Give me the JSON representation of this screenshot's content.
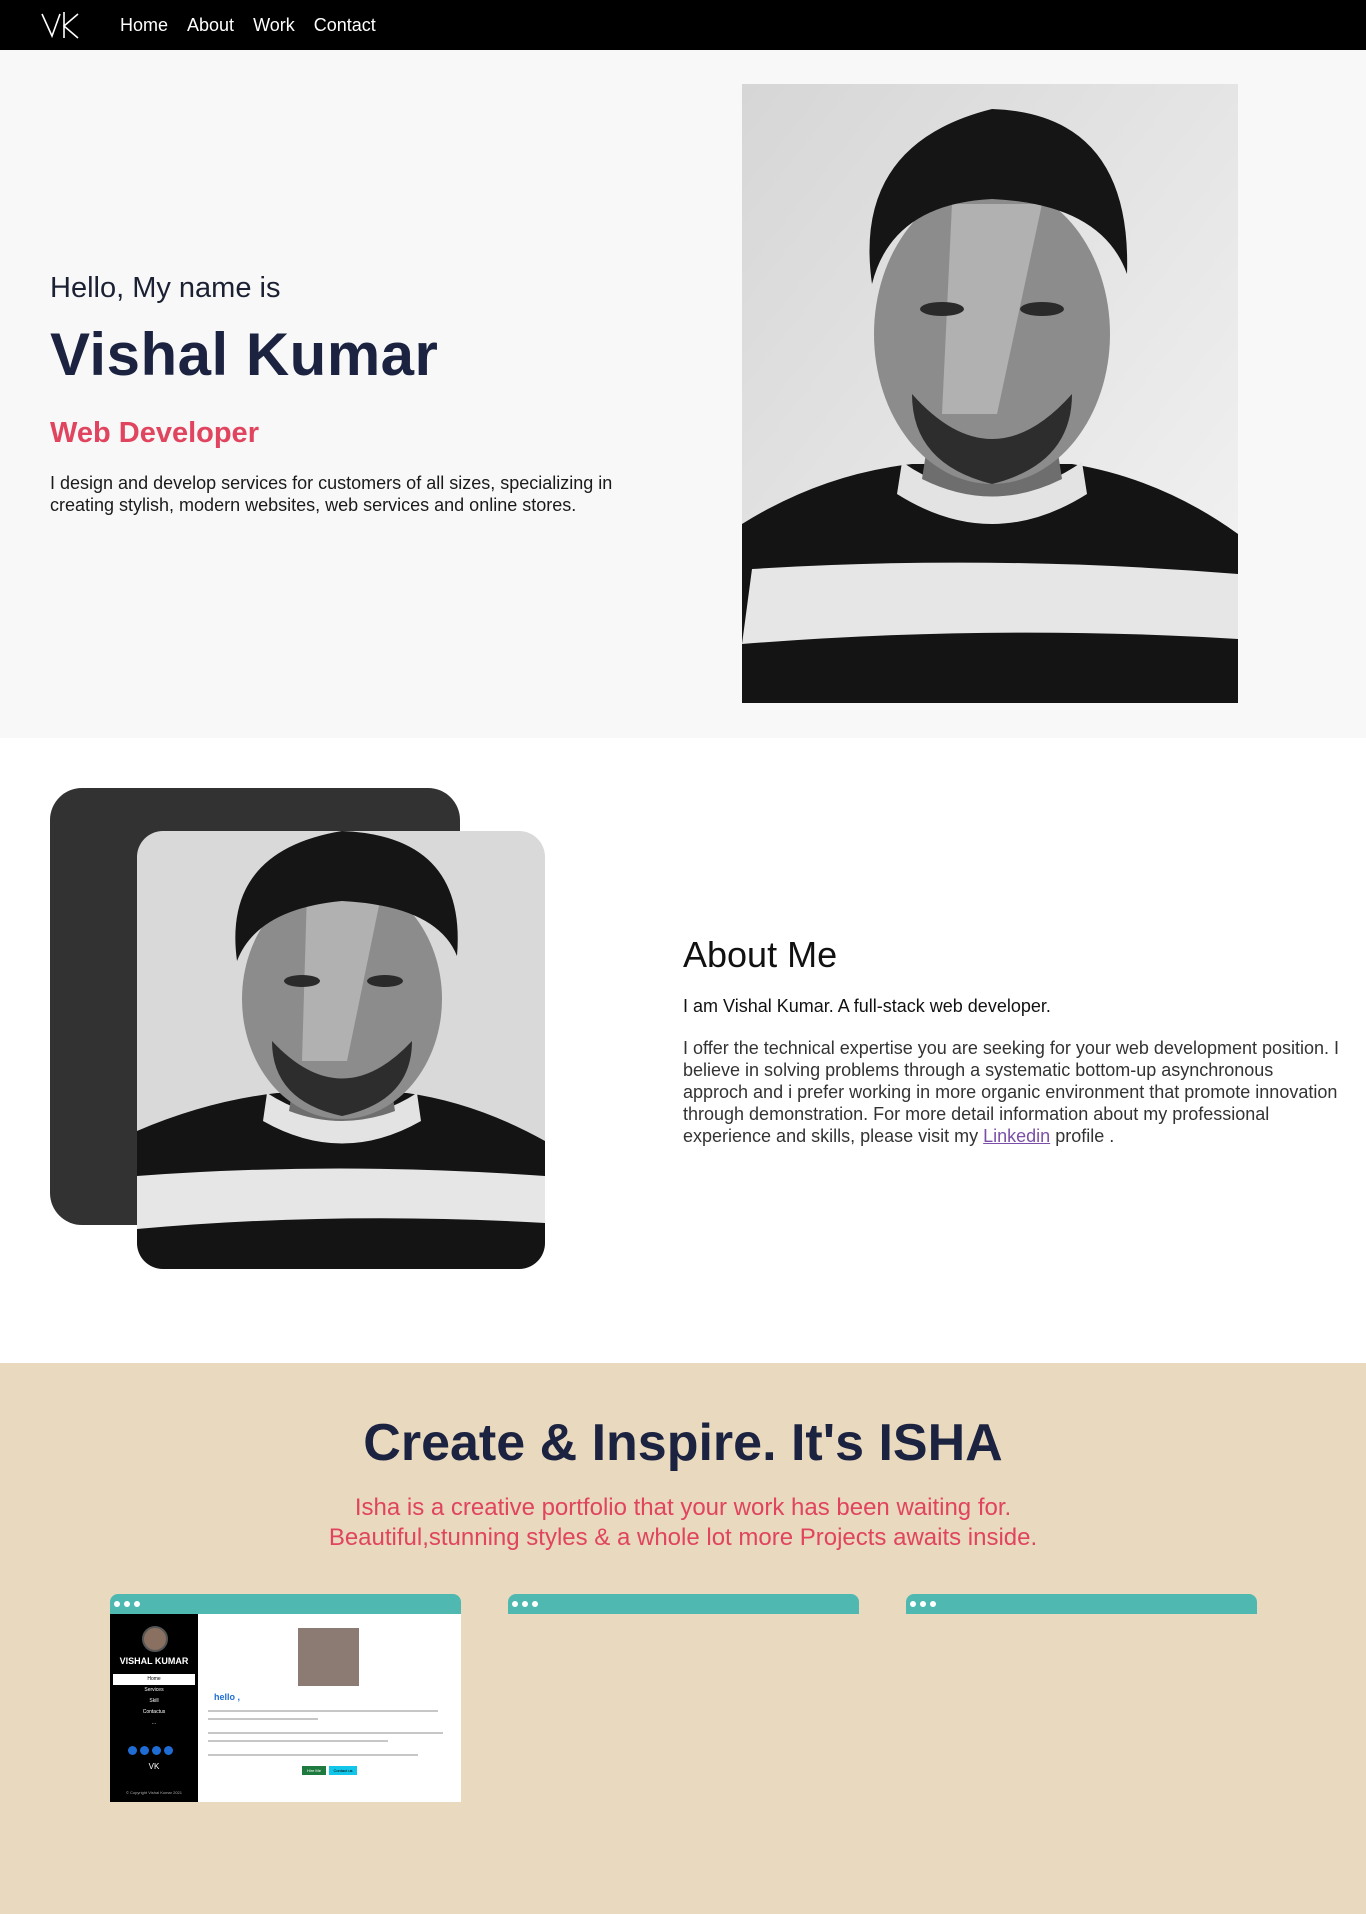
{
  "nav": {
    "logo_icon": "vk-monogram-logo",
    "links": [
      "Home",
      "About",
      "Work",
      "Contact"
    ]
  },
  "hero": {
    "greeting": "Hello, My name is",
    "name": "Vishal Kumar",
    "role": "Web Developer",
    "tagline": "I design and develop services for customers of all sizes, specializing in creating stylish, modern websites, web services and online stores."
  },
  "about": {
    "title": "About Me",
    "intro": "I am Vishal Kumar. A full-stack web developer.",
    "body_before_link": "I offer the technical expertise you are seeking for your web development position. I believe in solving problems through a systematic bottom-up asynchronous approch and i prefer working in more organic environment that promote innovation through demonstration. For more detail information about my professional experience and skills, please visit my ",
    "link_label": "Linkedin",
    "body_after_link": " profile ."
  },
  "work": {
    "title": "Create & Inspire. It's ISHA",
    "subtitle_line1": "Isha is a creative portfolio that your work has been waiting for.",
    "subtitle_line2": "Beautiful,stunning styles & a whole lot more Projects awaits inside.",
    "preview": {
      "name": "VISHAL KUMAR",
      "menu": [
        "Home",
        "Services",
        "Skill",
        "Contactus",
        "..."
      ],
      "hello": "hello ,",
      "logo": "VK",
      "copyright": "© Copyright Vishal Kumar 2021",
      "btn_hire": "Hire Me",
      "btn_contact": "Contact us"
    }
  },
  "colors": {
    "nav_bg": "#000000",
    "accent": "#e0445e",
    "heading": "#1b2340",
    "work_bg": "#e9d9bf",
    "card_bar": "#4fb9b1"
  }
}
